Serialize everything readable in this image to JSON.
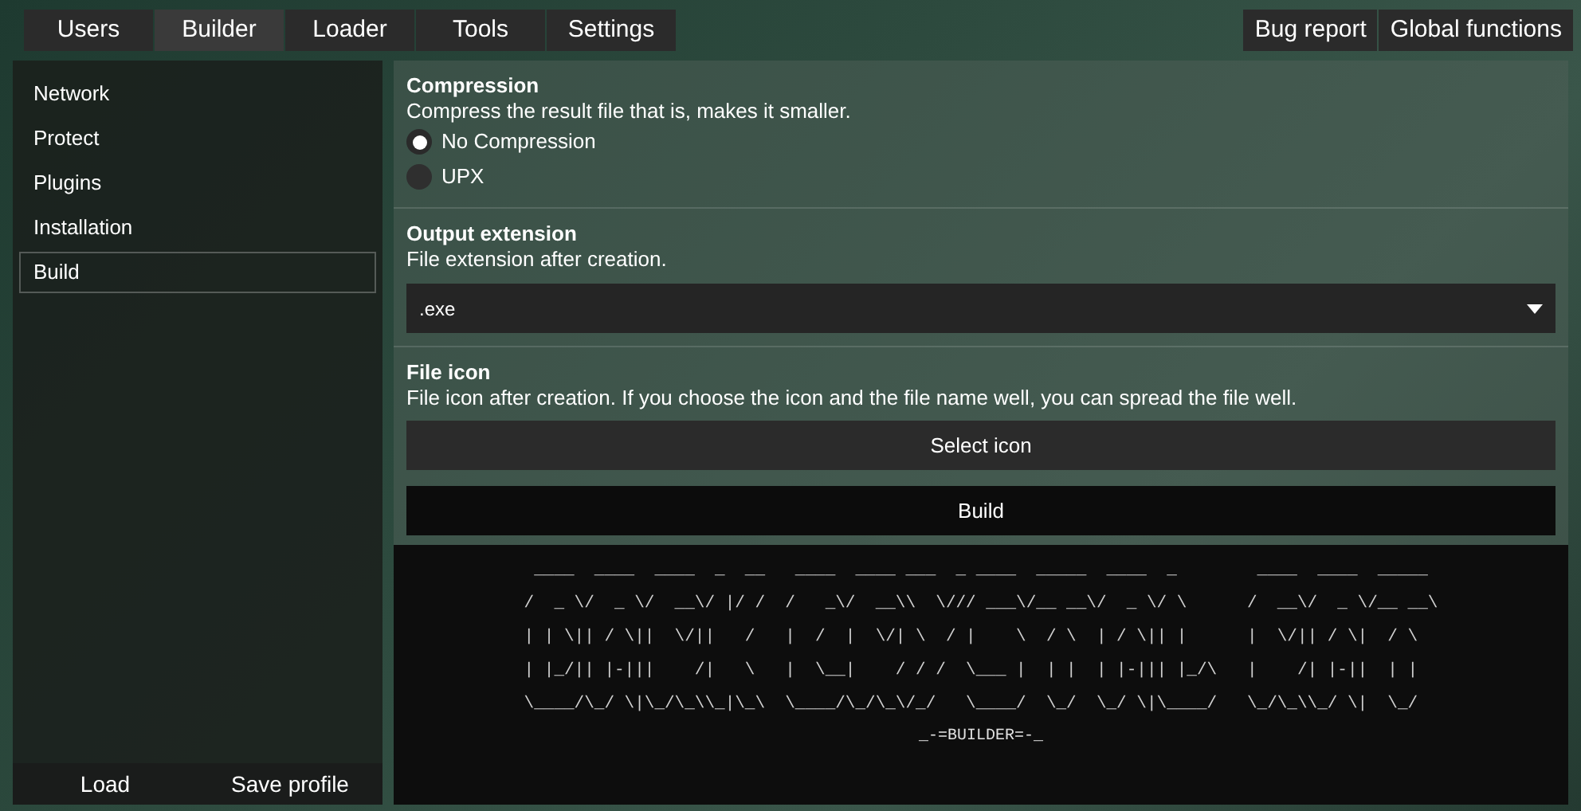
{
  "menu_tabs": [
    {
      "label": "Users",
      "selected": false
    },
    {
      "label": "Builder",
      "selected": true
    },
    {
      "label": "Loader",
      "selected": false
    },
    {
      "label": "Tools",
      "selected": false
    },
    {
      "label": "Settings",
      "selected": false
    }
  ],
  "right_buttons": [
    "Bug report",
    "Global functions"
  ],
  "sidebar": {
    "items": [
      {
        "label": "Network",
        "selected": false
      },
      {
        "label": "Protect",
        "selected": false
      },
      {
        "label": "Plugins",
        "selected": false
      },
      {
        "label": "Installation",
        "selected": false
      },
      {
        "label": "Build",
        "selected": true
      }
    ],
    "buttons": [
      "Load",
      "Save profile"
    ]
  },
  "compression": {
    "title": "Compression",
    "description": "Compress the result file that is, makes it smaller.",
    "options": [
      {
        "label": "No Compression",
        "selected": true
      },
      {
        "label": "UPX",
        "selected": false
      }
    ]
  },
  "output_extension": {
    "title": "Output extension",
    "description": "File extension after creation.",
    "value": ".exe"
  },
  "file_icon": {
    "title": "File icon",
    "description": "File icon after creation. If you choose the icon and the file name well, you can spread the file well.",
    "button": "Select icon"
  },
  "build_button": "Build",
  "banner": {
    "lines": [
      " ____  ____  ____  _  __   ____  ____ ___  _ ____  _____  ____  _        ____  ____  _____",
      "/  _ \\/  _ \\/  __\\/ |/ /  /   _\\/  __\\\\  \\/// ___\\/__ __\\/  _ \\/ \\      /  __\\/  _ \\/__ __\\",
      "| | \\|| / \\||  \\/||   /   |  /  |  \\/| \\  / |    \\  / \\  | / \\|| |      |  \\/|| / \\|  / \\",
      "| |_/|| |-|||    /|   \\   |  \\__|    / / /  \\___ |  | |  | |-||| |_/\\   |    /| |-||  | |",
      "\\____/\\_/ \\|\\_/\\_\\\\_|\\_\\  \\____/\\_/\\_\\/_/   \\____/  \\_/  \\_/ \\|\\____/   \\_/\\_\\\\_/ \\|  \\_/"
    ],
    "caption": "_-=BUILDER=-_"
  }
}
